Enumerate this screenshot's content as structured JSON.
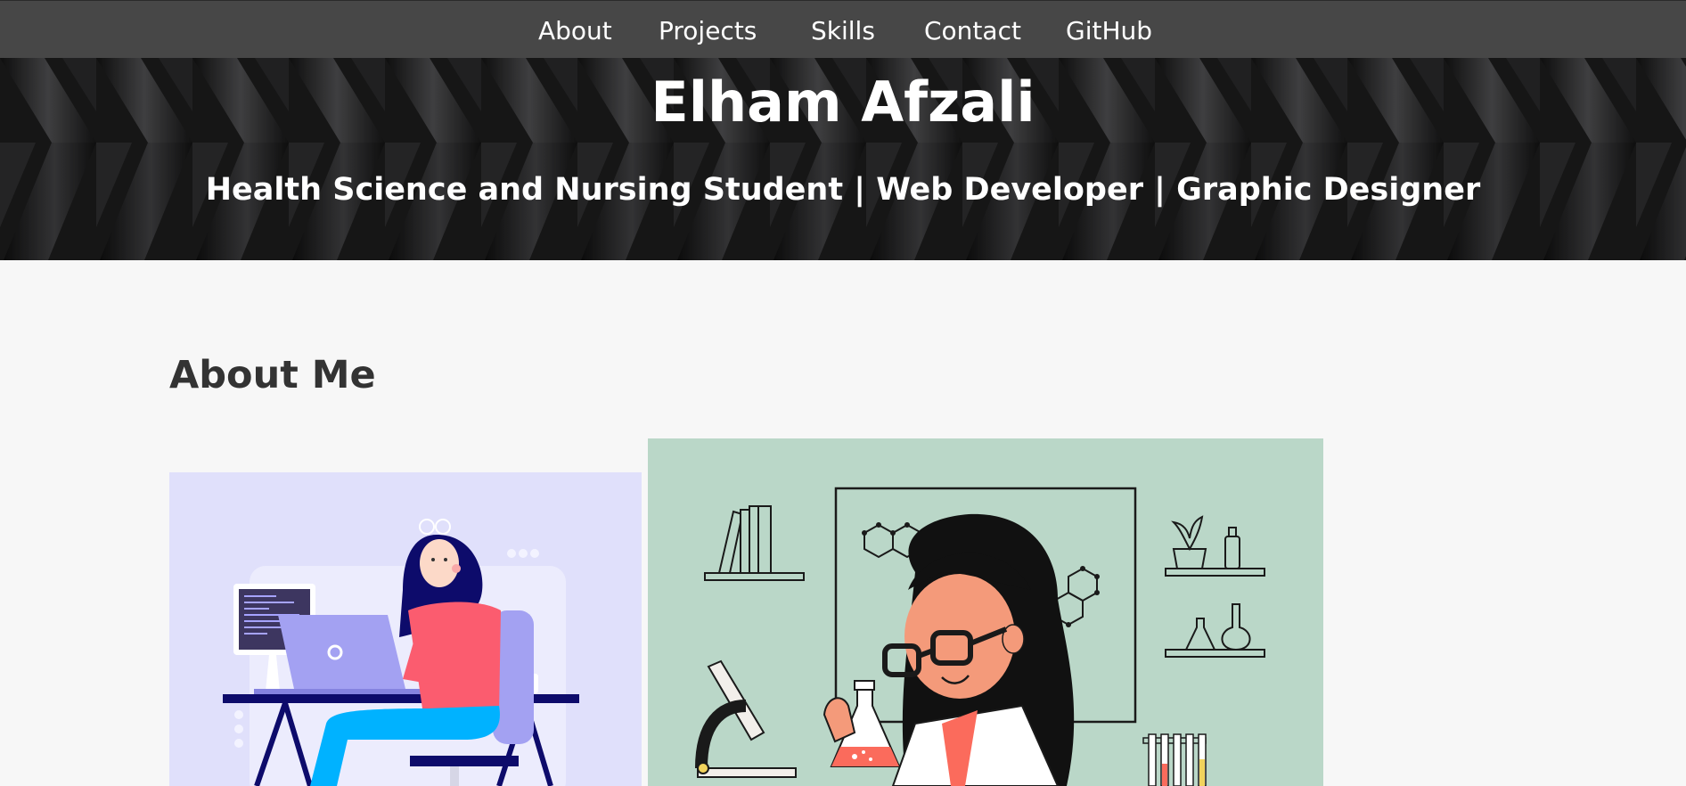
{
  "nav": {
    "items": [
      {
        "label": "About"
      },
      {
        "label": "Projects"
      },
      {
        "label": "Skills"
      },
      {
        "label": "Contact"
      },
      {
        "label": "GitHub"
      }
    ]
  },
  "hero": {
    "title": "Elham Afzali",
    "subtitle": "Health Science and Nursing Student | Web Developer | Graphic Designer"
  },
  "about": {
    "heading": "About Me",
    "images": [
      {
        "icon": "developer-illustration"
      },
      {
        "icon": "scientist-illustration"
      }
    ]
  },
  "colors": {
    "nav_bg": "#474747",
    "hero_bg": "#1c1c1c",
    "page_bg": "#f7f7f7",
    "dev_bg": "#e0e0fb",
    "lab_bg": "#bad7c8",
    "accent_pink": "#fb5c6f",
    "accent_purple": "#a3a1f2",
    "accent_navy": "#0d0b6b"
  }
}
